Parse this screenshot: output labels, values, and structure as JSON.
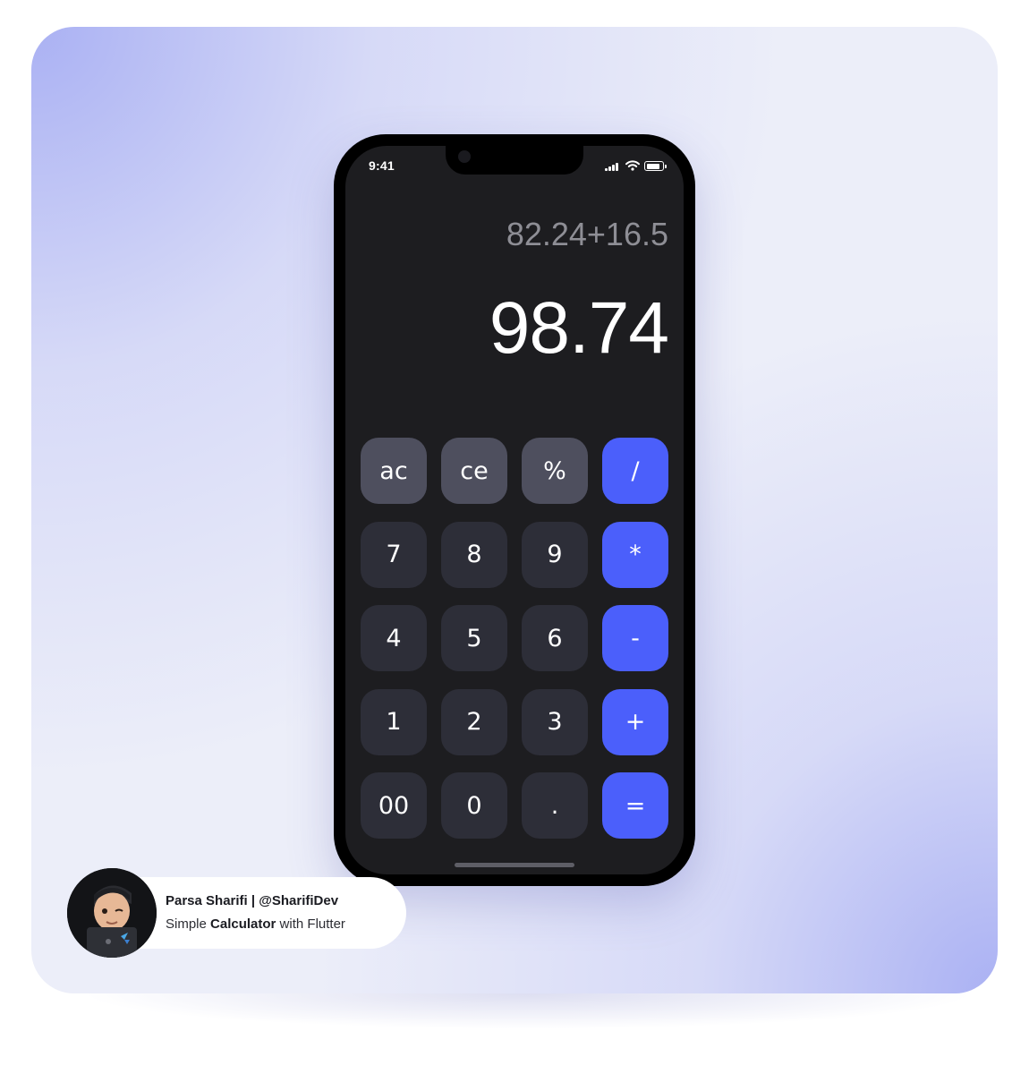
{
  "status_bar": {
    "time": "9:41"
  },
  "display": {
    "expression": "82.24+16.5",
    "result": "98.74"
  },
  "keypad": {
    "rows": [
      [
        {
          "label": "ac",
          "kind": "function"
        },
        {
          "label": "ce",
          "kind": "function"
        },
        {
          "label": "%",
          "kind": "function"
        },
        {
          "label": "/",
          "kind": "operator"
        }
      ],
      [
        {
          "label": "7",
          "kind": "digit"
        },
        {
          "label": "8",
          "kind": "digit"
        },
        {
          "label": "9",
          "kind": "digit"
        },
        {
          "label": "*",
          "kind": "operator"
        }
      ],
      [
        {
          "label": "4",
          "kind": "digit"
        },
        {
          "label": "5",
          "kind": "digit"
        },
        {
          "label": "6",
          "kind": "digit"
        },
        {
          "label": "-",
          "kind": "operator"
        }
      ],
      [
        {
          "label": "1",
          "kind": "digit"
        },
        {
          "label": "2",
          "kind": "digit"
        },
        {
          "label": "3",
          "kind": "digit"
        },
        {
          "label": "+",
          "kind": "operator"
        }
      ],
      [
        {
          "label": "00",
          "kind": "digit"
        },
        {
          "label": "0",
          "kind": "digit"
        },
        {
          "label": ".",
          "kind": "digit"
        },
        {
          "label": "=",
          "kind": "operator"
        }
      ]
    ]
  },
  "author": {
    "name": "Parsa Sharifi | @SharifiDev",
    "subtitle_pre": "Simple ",
    "subtitle_highlight": "Calculator",
    "subtitle_post": " with Flutter"
  },
  "colors": {
    "accent": "#4b5ffb",
    "function_key": "#4e4f5e",
    "digit_key": "#2d2e38",
    "screen_background": "#1d1d20",
    "card_background": "#eceef9"
  },
  "icons": [
    "signal-icon",
    "wifi-icon",
    "battery-icon",
    "camera-icon",
    "avatar"
  ]
}
